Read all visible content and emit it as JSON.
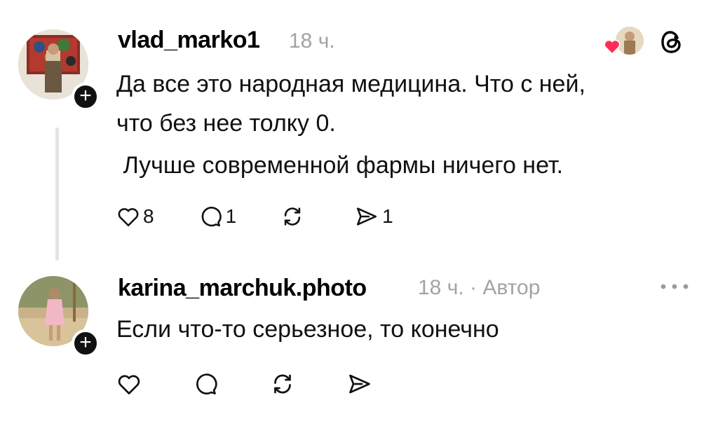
{
  "posts": [
    {
      "username": "vlad_marko1",
      "time": "18 ч.",
      "author_tag": "",
      "lines": [
        "Да все это народная медицина. Что с ней,",
        "что без нее толку 0.",
        " Лучше современной фармы ничего нет."
      ],
      "counts": {
        "like": "8",
        "reply": "1",
        "repost": "",
        "share": "1"
      }
    },
    {
      "username": "karina_marchuk.photo",
      "time": "18 ч.",
      "author_tag": "Автор",
      "separator": "·",
      "lines": [
        "Если что-то серьезное, то конечно"
      ],
      "counts": {
        "like": "",
        "reply": "",
        "repost": "",
        "share": ""
      }
    }
  ],
  "colors": {
    "heart_badge": "#ff2d55",
    "meta_gray": "#a3a3a3",
    "thread_line": "#e3e3e3"
  },
  "icons": [
    "heart-icon",
    "comment-icon",
    "repost-icon",
    "share-icon",
    "threads-logo-icon",
    "more-icon",
    "plus-icon"
  ]
}
